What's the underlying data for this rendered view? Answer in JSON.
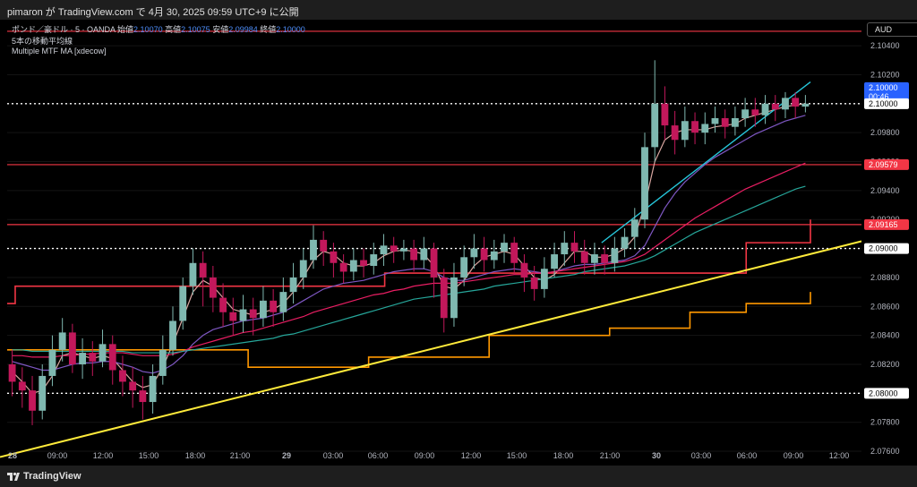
{
  "header": {
    "publish_text": "pimaron が TradingView.com で 4月 30, 2025 09:59 UTC+9 に公開"
  },
  "legend": {
    "symbol": "ポンド／豪ドル · 5 · OANDA",
    "open_label": "始値",
    "open": "2.10070",
    "high_label": "高値",
    "high": "2.10075",
    "low_label": "安値",
    "low": "2.09984",
    "close_label": "終値",
    "close": "2.10000",
    "indicator1": "5本の移動平均線",
    "indicator2": "Multiple MTF MA [xdecow]"
  },
  "currency": "AUD",
  "footer": {
    "brand": "TradingView"
  },
  "chart_data": {
    "type": "candlestick",
    "x_ticks": [
      "28",
      "09:00",
      "12:00",
      "15:00",
      "18:00",
      "21:00",
      "29",
      "03:00",
      "06:00",
      "09:00",
      "12:00",
      "15:00",
      "18:00",
      "21:00",
      "30",
      "03:00",
      "06:00",
      "09:00",
      "12:00"
    ],
    "y_ticks": [
      "2.07600",
      "2.07800",
      "2.08000",
      "2.08200",
      "2.08400",
      "2.08600",
      "2.08800",
      "2.09000",
      "2.09200",
      "2.09400",
      "2.09600",
      "2.09800",
      "2.10000",
      "2.10200",
      "2.10400"
    ],
    "ylim": [
      2.0752,
      2.1058
    ],
    "price_labels": [
      {
        "value": 2.1,
        "text": "2.10000",
        "time": "00:46",
        "color": "#2962ff"
      },
      {
        "value": 2.1,
        "text": "2.10000",
        "color": "#ffffff"
      },
      {
        "value": 2.09579,
        "text": "2.09579",
        "color": "#f23645"
      },
      {
        "value": 2.09165,
        "text": "2.09165",
        "color": "#f23645"
      },
      {
        "value": 2.09,
        "text": "2.09000",
        "color": "#ffffff"
      },
      {
        "value": 2.08,
        "text": "2.08000",
        "color": "#ffffff"
      }
    ],
    "horizontal_lines": [
      {
        "value": 2.105,
        "style": "solid",
        "color": "#f23645"
      },
      {
        "value": 2.09579,
        "style": "solid",
        "color": "#f23645"
      },
      {
        "value": 2.09165,
        "style": "solid",
        "color": "#f23645"
      },
      {
        "value": 2.1,
        "style": "dotted",
        "color": "#ffffff"
      },
      {
        "value": 2.09,
        "style": "dotted",
        "color": "#ffffff"
      },
      {
        "value": 2.08,
        "style": "dotted",
        "color": "#ffffff"
      }
    ],
    "trend_line": {
      "from": [
        0,
        2.0756
      ],
      "to": [
        1.0,
        2.0905
      ],
      "color": "#ffeb3b"
    },
    "step_lines": {
      "red": [
        [
          0,
          2.0862
        ],
        [
          0.01,
          2.0874
        ],
        [
          0.35,
          2.0874
        ],
        [
          0.47,
          2.0883
        ],
        [
          0.92,
          2.0883
        ],
        [
          0.92,
          2.0904
        ],
        [
          1.0,
          2.0904
        ],
        [
          1.0,
          2.092
        ]
      ],
      "orange": [
        [
          0,
          2.083
        ],
        [
          0.3,
          2.0818
        ],
        [
          0.45,
          2.0825
        ],
        [
          0.6,
          2.084
        ],
        [
          0.75,
          2.0845
        ],
        [
          0.85,
          2.0856
        ],
        [
          0.92,
          2.0862
        ],
        [
          1.0,
          2.0862
        ],
        [
          1.0,
          2.087
        ]
      ]
    },
    "candles": [
      [
        2.082,
        2.0808,
        2.0798,
        2.083
      ],
      [
        2.0808,
        2.0802,
        2.079,
        2.0818
      ],
      [
        2.0802,
        2.0788,
        2.0778,
        2.0812
      ],
      [
        2.0788,
        2.0812,
        2.0782,
        2.082
      ],
      [
        2.0812,
        2.083,
        2.0805,
        2.084
      ],
      [
        2.083,
        2.0842,
        2.0822,
        2.0852
      ],
      [
        2.0842,
        2.082,
        2.0814,
        2.0848
      ],
      [
        2.082,
        2.0828,
        2.081,
        2.0838
      ],
      [
        2.0828,
        2.0822,
        2.0812,
        2.0836
      ],
      [
        2.0822,
        2.0834,
        2.0818,
        2.0844
      ],
      [
        2.0834,
        2.0816,
        2.0806,
        2.084
      ],
      [
        2.0816,
        2.0808,
        2.0798,
        2.0826
      ],
      [
        2.0808,
        2.0802,
        2.079,
        2.0818
      ],
      [
        2.0802,
        2.0794,
        2.0782,
        2.0812
      ],
      [
        2.0794,
        2.0812,
        2.0786,
        2.082
      ],
      [
        2.0812,
        2.083,
        2.0806,
        2.084
      ],
      [
        2.083,
        2.085,
        2.0826,
        2.086
      ],
      [
        2.085,
        2.0874,
        2.0844,
        2.088
      ],
      [
        2.0874,
        2.089,
        2.0868,
        2.09
      ],
      [
        2.089,
        2.088,
        2.086,
        2.0898
      ],
      [
        2.088,
        2.0866,
        2.0856,
        2.0888
      ],
      [
        2.0866,
        2.0856,
        2.0846,
        2.0876
      ],
      [
        2.0856,
        2.085,
        2.084,
        2.0866
      ],
      [
        2.085,
        2.0858,
        2.0842,
        2.0868
      ],
      [
        2.0858,
        2.0852,
        2.084,
        2.0866
      ],
      [
        2.0852,
        2.0864,
        2.0846,
        2.0874
      ],
      [
        2.0864,
        2.0856,
        2.0846,
        2.0872
      ],
      [
        2.0856,
        2.087,
        2.085,
        2.088
      ],
      [
        2.087,
        2.088,
        2.0862,
        2.089
      ],
      [
        2.088,
        2.0892,
        2.0872,
        2.09
      ],
      [
        2.0892,
        2.0906,
        2.0886,
        2.0916
      ],
      [
        2.0906,
        2.0898,
        2.0888,
        2.0912
      ],
      [
        2.0898,
        2.089,
        2.088,
        2.0904
      ],
      [
        2.089,
        2.0884,
        2.0876,
        2.0896
      ],
      [
        2.0884,
        2.0892,
        2.0878,
        2.09
      ],
      [
        2.0892,
        2.0888,
        2.088,
        2.09
      ],
      [
        2.0888,
        2.0896,
        2.0882,
        2.0904
      ],
      [
        2.0896,
        2.0902,
        2.0888,
        2.091
      ],
      [
        2.0902,
        2.0898,
        2.089,
        2.0908
      ],
      [
        2.0898,
        2.09,
        2.0892,
        2.0906
      ],
      [
        2.09,
        2.0892,
        2.0884,
        2.0906
      ],
      [
        2.0892,
        2.09,
        2.0886,
        2.0908
      ],
      [
        2.09,
        2.088,
        2.0866,
        2.0904
      ],
      [
        2.088,
        2.0852,
        2.0842,
        2.0886
      ],
      [
        2.0852,
        2.088,
        2.0846,
        2.089
      ],
      [
        2.088,
        2.0894,
        2.0874,
        2.0902
      ],
      [
        2.0894,
        2.09,
        2.0886,
        2.091
      ],
      [
        2.09,
        2.0892,
        2.0884,
        2.0908
      ],
      [
        2.0892,
        2.0898,
        2.0886,
        2.0906
      ],
      [
        2.0898,
        2.0904,
        2.089,
        2.091
      ],
      [
        2.0904,
        2.089,
        2.0882,
        2.0908
      ],
      [
        2.089,
        2.088,
        2.087,
        2.0896
      ],
      [
        2.088,
        2.0872,
        2.0864,
        2.0888
      ],
      [
        2.0872,
        2.0886,
        2.0866,
        2.0894
      ],
      [
        2.0886,
        2.0896,
        2.088,
        2.0904
      ],
      [
        2.0896,
        2.0904,
        2.0888,
        2.0912
      ],
      [
        2.0904,
        2.0898,
        2.089,
        2.0912
      ],
      [
        2.0898,
        2.089,
        2.0882,
        2.0906
      ],
      [
        2.089,
        2.0896,
        2.0882,
        2.0904
      ],
      [
        2.0896,
        2.089,
        2.0882,
        2.0902
      ],
      [
        2.089,
        2.09,
        2.0884,
        2.0908
      ],
      [
        2.09,
        2.0908,
        2.0894,
        2.0914
      ],
      [
        2.0908,
        2.092,
        2.09,
        2.0928
      ],
      [
        2.092,
        2.097,
        2.0914,
        2.098
      ],
      [
        2.097,
        2.1,
        2.096,
        2.103
      ],
      [
        2.1,
        2.0985,
        2.0975,
        2.1012
      ],
      [
        2.0985,
        2.0975,
        2.0965,
        2.0995
      ],
      [
        2.0975,
        2.0988,
        2.097,
        2.0998
      ],
      [
        2.0988,
        2.098,
        2.0972,
        2.0994
      ],
      [
        2.098,
        2.0986,
        2.0972,
        2.0994
      ],
      [
        2.0986,
        2.099,
        2.098,
        2.0998
      ],
      [
        2.099,
        2.0984,
        2.0976,
        2.0996
      ],
      [
        2.0984,
        2.099,
        2.0978,
        2.0998
      ],
      [
        2.099,
        2.0996,
        2.0984,
        2.1004
      ],
      [
        2.0996,
        2.0992,
        2.0984,
        2.1004
      ],
      [
        2.0992,
        2.1,
        2.0986,
        2.1006
      ],
      [
        2.1,
        2.0996,
        2.0988,
        2.1006
      ],
      [
        2.0996,
        2.1004,
        2.099,
        2.1008
      ],
      [
        2.1004,
        2.0998,
        2.099,
        2.1008
      ],
      [
        2.0998,
        2.1,
        2.0994,
        2.1006
      ]
    ],
    "ma_lines": [
      {
        "color": "#d9a7a1",
        "values": [
          2.0815,
          2.0808,
          2.08,
          2.0802,
          2.0812,
          2.0826,
          2.0828,
          2.0826,
          2.0824,
          2.0826,
          2.0824,
          2.0816,
          2.0808,
          2.0804,
          2.0806,
          2.0818,
          2.0834,
          2.0852,
          2.087,
          2.0878,
          2.0874,
          2.0866,
          2.0858,
          2.0856,
          2.0854,
          2.0856,
          2.0858,
          2.0862,
          2.087,
          2.088,
          2.0892,
          2.0898,
          2.0896,
          2.089,
          2.0888,
          2.0888,
          2.089,
          2.0895,
          2.0898,
          2.0899,
          2.0898,
          2.0896,
          2.0888,
          2.0874,
          2.0872,
          2.0878,
          2.0888,
          2.0894,
          2.0896,
          2.0898,
          2.0896,
          2.0888,
          2.088,
          2.0878,
          2.0882,
          2.089,
          2.0898,
          2.0898,
          2.0894,
          2.0894,
          2.0896,
          2.09,
          2.0908,
          2.093,
          2.096,
          2.0975,
          2.098,
          2.0982,
          2.0982,
          2.0982,
          2.0984,
          2.0985,
          2.0986,
          2.099,
          2.0992,
          2.0994,
          2.0996,
          2.0998,
          2.0999,
          2.1
        ]
      },
      {
        "color": "#7e57c2",
        "values": [
          2.0822,
          2.082,
          2.0818,
          2.0816,
          2.0816,
          2.0818,
          2.082,
          2.0821,
          2.0821,
          2.0822,
          2.0822,
          2.082,
          2.0818,
          2.0815,
          2.0814,
          2.0816,
          2.082,
          2.0826,
          2.0834,
          2.084,
          2.0844,
          2.0846,
          2.0848,
          2.085,
          2.0851,
          2.0852,
          2.0854,
          2.0856,
          2.086,
          2.0864,
          2.0868,
          2.0872,
          2.0874,
          2.0876,
          2.0877,
          2.0878,
          2.088,
          2.0882,
          2.0884,
          2.0885,
          2.0886,
          2.0886,
          2.0884,
          2.088,
          2.0878,
          2.0878,
          2.088,
          2.0882,
          2.0884,
          2.0885,
          2.0886,
          2.0885,
          2.0884,
          2.0883,
          2.0884,
          2.0886,
          2.0888,
          2.0889,
          2.0889,
          2.089,
          2.0891,
          2.0892,
          2.0895,
          2.0902,
          2.0915,
          2.0928,
          2.0938,
          2.0946,
          2.0952,
          2.0958,
          2.0963,
          2.0967,
          2.0971,
          2.0975,
          2.0979,
          2.0982,
          2.0985,
          2.0988,
          2.099,
          2.0992
        ]
      },
      {
        "color": "#e91e63",
        "values": [
          2.0826,
          2.0826,
          2.0825,
          2.0825,
          2.0825,
          2.0826,
          2.0826,
          2.0827,
          2.0827,
          2.0828,
          2.0828,
          2.0828,
          2.0827,
          2.0826,
          2.0826,
          2.0826,
          2.0827,
          2.0829,
          2.0832,
          2.0834,
          2.0836,
          2.0838,
          2.084,
          2.0842,
          2.0843,
          2.0845,
          2.0847,
          2.0849,
          2.0851,
          2.0853,
          2.0856,
          2.0858,
          2.086,
          2.0862,
          2.0864,
          2.0866,
          2.0868,
          2.0869,
          2.0871,
          2.0872,
          2.0874,
          2.0875,
          2.0876,
          2.0876,
          2.0876,
          2.0877,
          2.0878,
          2.0879,
          2.088,
          2.0881,
          2.0882,
          2.0882,
          2.0883,
          2.0883,
          2.0884,
          2.0885,
          2.0886,
          2.0887,
          2.0888,
          2.0889,
          2.089,
          2.0891,
          2.0893,
          2.0896,
          2.0901,
          2.0906,
          2.0911,
          2.0916,
          2.0921,
          2.0925,
          2.0929,
          2.0933,
          2.0937,
          2.0941,
          2.0944,
          2.0947,
          2.095,
          2.0953,
          2.0956,
          2.0959
        ]
      },
      {
        "color": "#26a69a",
        "values": [
          2.083,
          2.083,
          2.0829,
          2.0829,
          2.0829,
          2.0829,
          2.0829,
          2.0829,
          2.0829,
          2.0829,
          2.0829,
          2.0829,
          2.0828,
          2.0828,
          2.0828,
          2.0828,
          2.0828,
          2.0829,
          2.083,
          2.0831,
          2.0832,
          2.0833,
          2.0834,
          2.0835,
          2.0836,
          2.0837,
          2.0838,
          2.084,
          2.0841,
          2.0843,
          2.0845,
          2.0847,
          2.0849,
          2.0851,
          2.0853,
          2.0855,
          2.0857,
          2.0859,
          2.0861,
          2.0863,
          2.0865,
          2.0866,
          2.0867,
          2.0868,
          2.0869,
          2.087,
          2.0871,
          2.0872,
          2.0874,
          2.0875,
          2.0876,
          2.0877,
          2.0878,
          2.0879,
          2.088,
          2.0881,
          2.0882,
          2.0884,
          2.0885,
          2.0886,
          2.0887,
          2.0888,
          2.089,
          2.0892,
          2.0895,
          2.0899,
          2.0903,
          2.0907,
          2.0911,
          2.0914,
          2.0917,
          2.092,
          2.0923,
          2.0926,
          2.0929,
          2.0932,
          2.0935,
          2.0938,
          2.0941,
          2.0943
        ]
      }
    ],
    "teal_trend": {
      "from": [
        0.74,
        2.0904
      ],
      "to": [
        1.0,
        2.1015
      ],
      "color": "#26c6da"
    }
  }
}
